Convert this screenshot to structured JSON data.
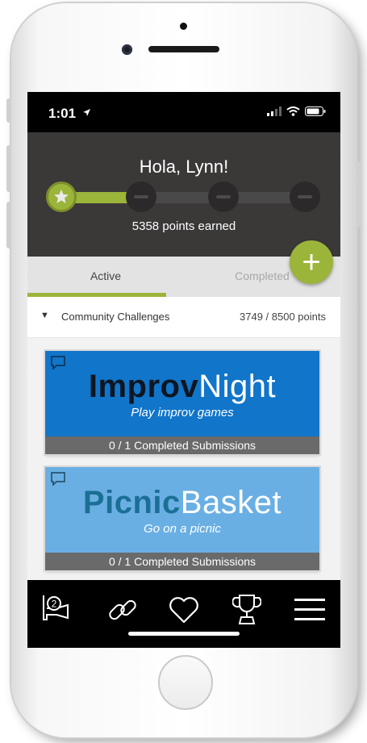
{
  "status_bar": {
    "time": "1:01",
    "location_icon": "location-arrow-icon",
    "signal_icon": "signal-icon",
    "wifi_icon": "wifi-icon",
    "battery_icon": "battery-icon"
  },
  "header": {
    "greeting": "Hola, Lynn!",
    "points_text": "5358 points earned",
    "progress_fraction": 0.33,
    "milestones_reached": 1,
    "milestones_total": 4
  },
  "fab": {
    "label": "+",
    "icon": "plus-icon"
  },
  "tabs": [
    {
      "label": "Active",
      "selected": true
    },
    {
      "label": "Completed",
      "selected": false
    }
  ],
  "section": {
    "caret": "▼",
    "title": "Community Challenges",
    "points": "3749 / 8500 points"
  },
  "challenges": [
    {
      "title_bold": "Improv",
      "title_light": "Night",
      "subtitle": "Play improv games",
      "submissions": "0 / 1 Completed Submissions",
      "color": "#1175c9",
      "title_bold_color": "#0d1620",
      "title_light_color": "#ffffff"
    },
    {
      "title_bold": "Picnic",
      "title_light": "Basket",
      "subtitle": "Go on a picnic",
      "submissions": "0 / 1 Completed Submissions",
      "color": "#6aafe3",
      "title_bold_color": "#1b6f95",
      "title_light_color": "#ffffff"
    }
  ],
  "nav_bar": {
    "items": [
      {
        "icon": "tickets-icon",
        "badge": "2"
      },
      {
        "icon": "link-icon"
      },
      {
        "icon": "heart-icon"
      },
      {
        "icon": "trophy-icon"
      },
      {
        "icon": "menu-icon"
      }
    ]
  },
  "colors": {
    "accent": "#9bb43a",
    "header_bg": "#3b3838",
    "tab_bg": "#e3e3e3"
  }
}
